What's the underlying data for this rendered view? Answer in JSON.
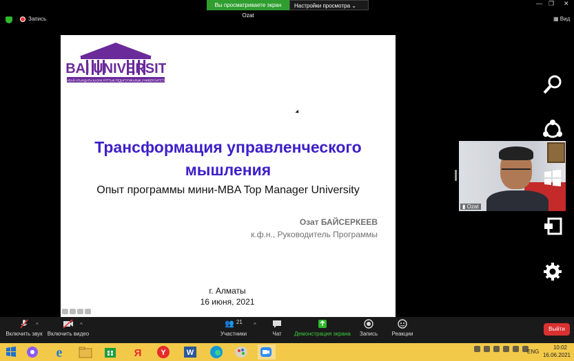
{
  "banner": {
    "notice": "Вы просматриваете экран Ozat",
    "settings": "Настройки просмотра"
  },
  "top": {
    "record_label": "Запись",
    "view_label": "Вид"
  },
  "slide": {
    "title_line1": "Трансформация управленческого",
    "title_line2": "мышления",
    "subtitle": "Опыт программы мини-MBA Top Manager University",
    "author": "Озат БАЙСЕРКЕЕВ",
    "role": "к.ф.н., Руководитель Программы",
    "city": "г. Алматы",
    "date": "16 июня, 2021",
    "logo_text": "ABAI UNIVERSITY",
    "logo_caption": "АБАЙ АТЫНДАҒЫ ҚАЗАҚ ҰЛТТЫҚ ПЕДАГОГИКАЛЫҚ УНИВЕРСИТЕТІ"
  },
  "video": {
    "name": "Ozat"
  },
  "toolbar": {
    "unmute": "Включить звук",
    "start_video": "Включить видео",
    "participants": "Участники",
    "participants_count": "21",
    "chat": "Чат",
    "share_screen": "Демонстрация экрана",
    "record": "Запись",
    "reactions": "Реакции",
    "leave": "Выйти"
  },
  "taskbar": {
    "lang": "ENG",
    "time": "10:02",
    "date": "16.06.2021"
  },
  "colors": {
    "banner_green": "#2f9e2f",
    "title_blue": "#3d20c9",
    "leave_red": "#d93030",
    "taskbar": "#f3c94a",
    "share_green": "#2eb82e"
  }
}
